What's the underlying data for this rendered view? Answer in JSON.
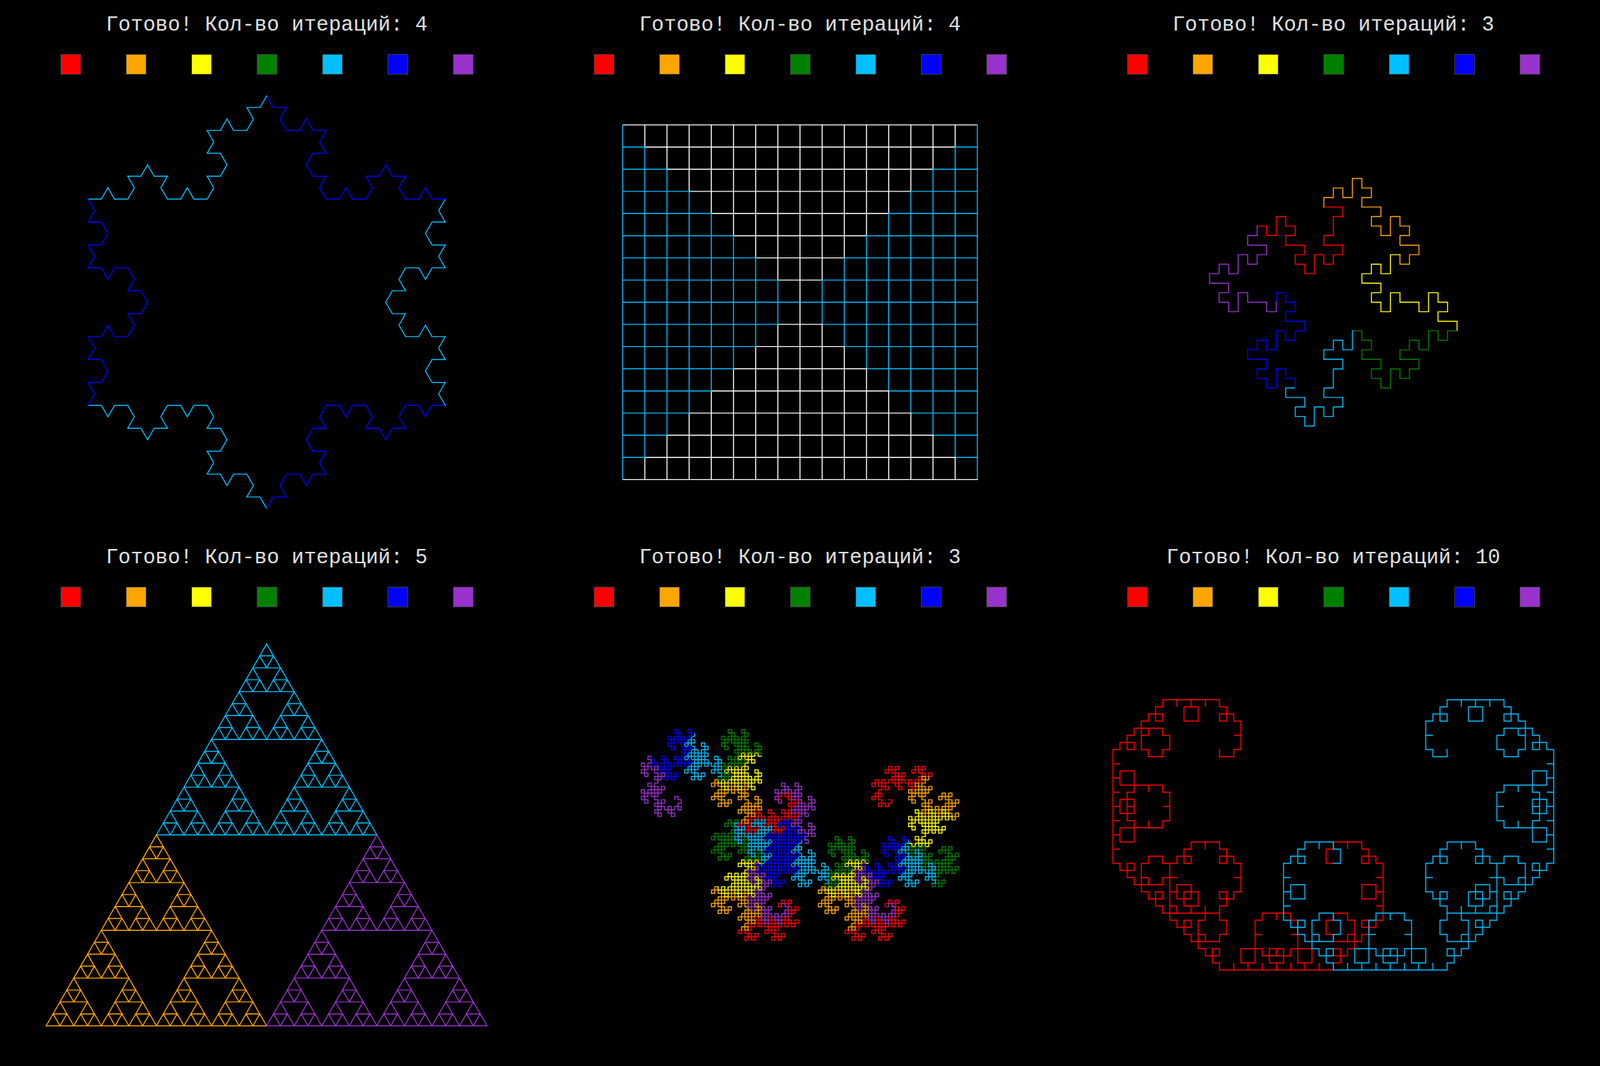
{
  "palette": [
    {
      "color": "#ff0000"
    },
    {
      "color": "#ffa500"
    },
    {
      "color": "#ffff00"
    },
    {
      "color": "#008000"
    },
    {
      "color": "#00bfff"
    },
    {
      "color": "#0000ff"
    },
    {
      "color": "#9932cc"
    }
  ],
  "panels": [
    {
      "status_label": "Готово! Кол-во итераций:",
      "iterations": "4",
      "kind": "koch",
      "colors": [
        "#00bfff",
        "#0000ff",
        "#00bfff",
        "#0000ff",
        "#00bfff",
        "#0000ff"
      ]
    },
    {
      "status_label": "Готово! Кол-во итераций:",
      "iterations": "4",
      "kind": "square",
      "colors": [
        "#ffffff",
        "#00bfff",
        "#ffffff",
        "#00bfff"
      ]
    },
    {
      "status_label": "Готово! Кол-во итераций:",
      "iterations": "3",
      "kind": "island",
      "colors": [
        "#ff0000",
        "#ffa500",
        "#ffff00",
        "#008000",
        "#00bfff",
        "#0000ff",
        "#9932cc"
      ]
    },
    {
      "status_label": "Готово! Кол-во итераций:",
      "iterations": "5",
      "kind": "sierpinski",
      "colors": [
        "#00bfff",
        "#ffa500",
        "#9932cc"
      ]
    },
    {
      "status_label": "Готово! Кол-во итераций:",
      "iterations": "3",
      "kind": "dragon",
      "colors": [
        "#ff0000",
        "#ffa500",
        "#ffff00",
        "#008000",
        "#00bfff",
        "#0000ff",
        "#9932cc"
      ]
    },
    {
      "status_label": "Готово! Кол-во итераций:",
      "iterations": "10",
      "kind": "levy",
      "colors": [
        "#ff0000",
        "#00bfff"
      ]
    }
  ]
}
